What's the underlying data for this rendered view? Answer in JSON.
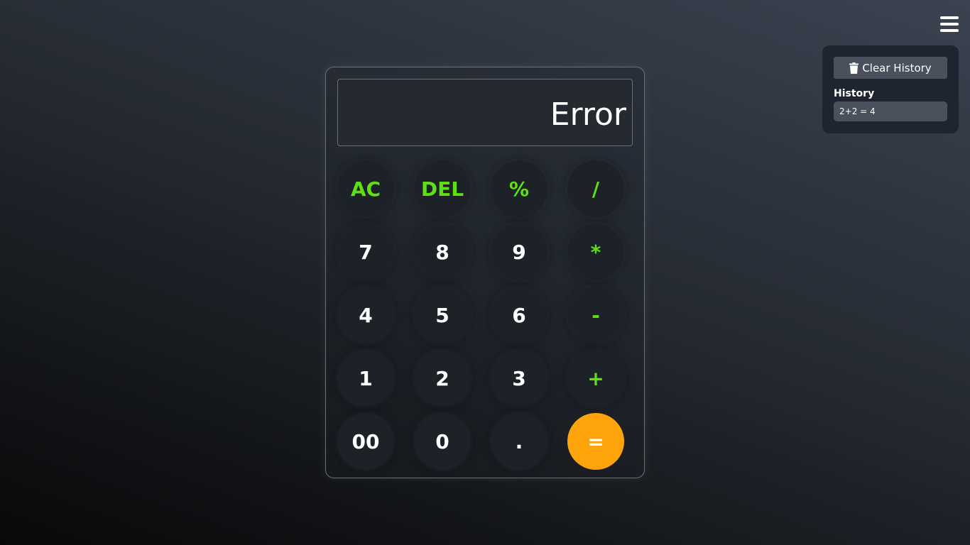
{
  "display": {
    "value": "Error"
  },
  "keys": {
    "ac": "AC",
    "del": "DEL",
    "percent": "%",
    "divide": "/",
    "seven": "7",
    "eight": "8",
    "nine": "9",
    "multiply": "*",
    "four": "4",
    "five": "5",
    "six": "6",
    "minus": "-",
    "one": "1",
    "two": "2",
    "three": "3",
    "plus": "+",
    "double_zero": "00",
    "zero": "0",
    "dot": ".",
    "equals": "="
  },
  "history": {
    "clear_label": "Clear History",
    "title": "History",
    "items": [
      "2+2 = 4"
    ]
  },
  "icons": {
    "menu": "hamburger-menu-icon",
    "trash": "trash-icon"
  },
  "colors": {
    "operator": "#5ee015",
    "equals": "#ffa40a"
  }
}
